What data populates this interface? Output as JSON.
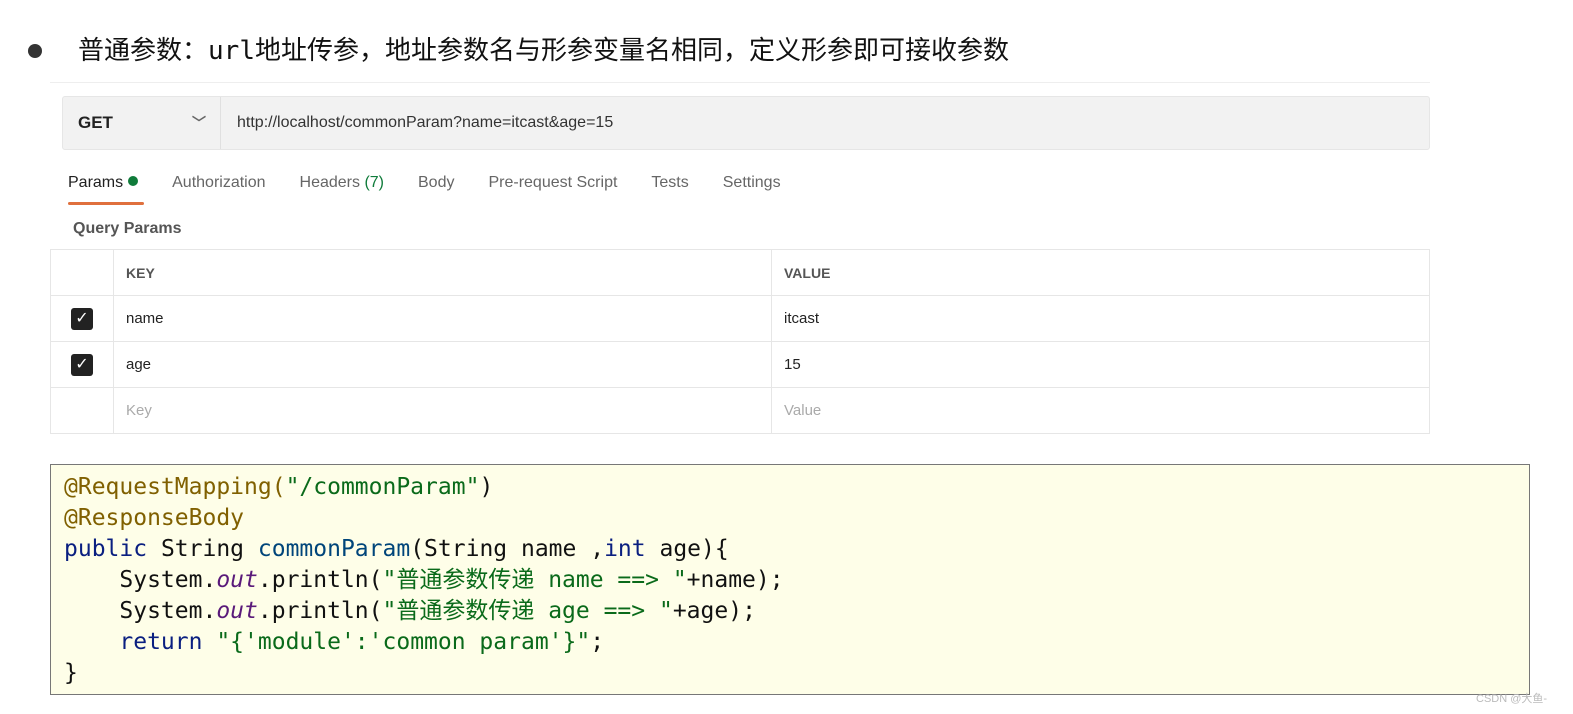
{
  "title": {
    "prefix": "普通参数：",
    "mono": "url",
    "rest": "地址传参，地址参数名与形参变量名相同，定义形参即可接收参数"
  },
  "request": {
    "method": "GET",
    "url": "http://localhost/commonParam?name=itcast&age=15"
  },
  "tabs": [
    {
      "label": "Params",
      "active": true
    },
    {
      "label": "Authorization"
    },
    {
      "label": "Headers ",
      "count": "(7)"
    },
    {
      "label": "Body"
    },
    {
      "label": "Pre-request Script"
    },
    {
      "label": "Tests"
    },
    {
      "label": "Settings"
    }
  ],
  "query_params": {
    "title": "Query Params",
    "headers": [
      "KEY",
      "VALUE"
    ],
    "rows": [
      {
        "key": "name",
        "value": "itcast",
        "checked": true
      },
      {
        "key": "age",
        "value": "15",
        "checked": true
      }
    ],
    "placeholder": {
      "key": "Key",
      "value": "Value"
    }
  },
  "code": [
    [
      [
        "ann",
        "@RequestMapping("
      ],
      [
        "str",
        "\"/commonParam\""
      ],
      [
        "pl",
        ")"
      ]
    ],
    [
      [
        "ann",
        "@ResponseBody"
      ]
    ],
    [
      [
        "kw",
        "public "
      ],
      [
        "pl",
        "String "
      ],
      [
        "fn",
        "commonParam"
      ],
      [
        "pl",
        "(String name ,"
      ],
      [
        "kw",
        "int"
      ],
      [
        "pl",
        " age){"
      ]
    ],
    [
      [
        "pl",
        "    System."
      ],
      [
        "it",
        "out"
      ],
      [
        "pl",
        ".println("
      ],
      [
        "str",
        "\"普通参数传递 name ==> \""
      ],
      [
        "pl",
        "+name);"
      ]
    ],
    [
      [
        "pl",
        "    System."
      ],
      [
        "it",
        "out"
      ],
      [
        "pl",
        ".println("
      ],
      [
        "str",
        "\"普通参数传递 age ==> \""
      ],
      [
        "pl",
        "+age);"
      ]
    ],
    [
      [
        "kw",
        "    return "
      ],
      [
        "str",
        "\"{'module':'common param'}\""
      ],
      [
        "pl",
        ";"
      ]
    ],
    [
      [
        "pl",
        "}"
      ]
    ]
  ],
  "watermark": "CSDN @大鱼-"
}
